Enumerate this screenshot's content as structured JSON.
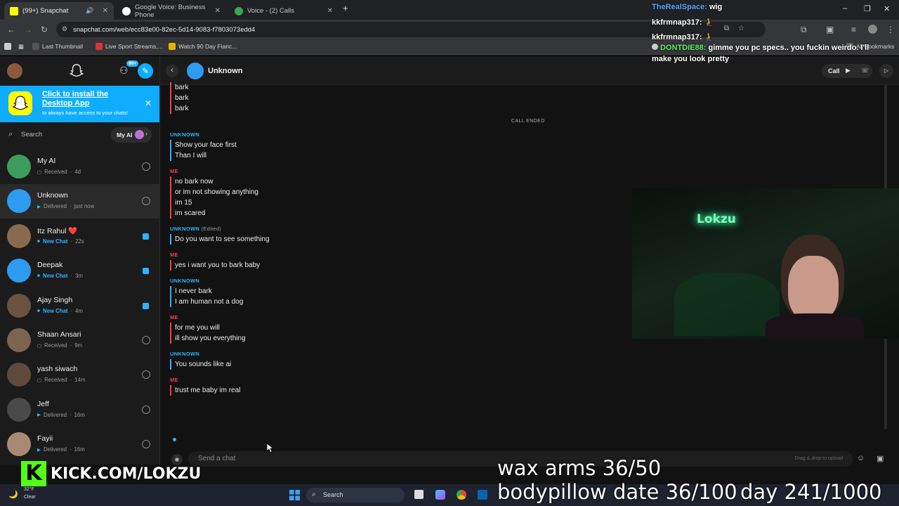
{
  "browser": {
    "tabs": [
      {
        "label": "(99+) Snapchat",
        "active": true
      },
      {
        "label": "Google Voice: Business Phone",
        "active": false
      },
      {
        "label": "Voice - (2) Calls",
        "active": false
      }
    ],
    "url": "snapchat.com/web/ecc83e00-82ec-5d14-9083-f7803073edd4",
    "bookmarks": [
      "Last Thumbnail",
      "Live Sport Streams,...",
      "Watch 90 Day Fianc...",
      "All Bookmarks"
    ]
  },
  "sidebar": {
    "badge": "99+",
    "promo": {
      "title": "Click to install the Desktop App",
      "subtitle": "to always have access to your chats!"
    },
    "search_placeholder": "Search",
    "my_ai_label": "My AI",
    "contacts": [
      {
        "name": "My AI",
        "status": "Received",
        "time": "4d",
        "kind": "received",
        "avatar": "#3b9c5b"
      },
      {
        "name": "Unknown",
        "status": "Delivered",
        "time": "just now",
        "kind": "delivered",
        "avatar": "#2d9bf0",
        "selected": true
      },
      {
        "name": "Itz Rahul ❤️",
        "status": "New Chat",
        "time": "22s",
        "kind": "new",
        "avatar": "#8a6a4f"
      },
      {
        "name": "Deepak",
        "status": "New Chat",
        "time": "3m",
        "kind": "new",
        "avatar": "#2d9bf0"
      },
      {
        "name": "Ajay Singh",
        "status": "New Chat",
        "time": "4m",
        "kind": "new",
        "avatar": "#6b5240"
      },
      {
        "name": "Shaan Ansari",
        "status": "Received",
        "time": "9m",
        "kind": "received",
        "avatar": "#7c6450"
      },
      {
        "name": "yash siwach",
        "status": "Received",
        "time": "14m",
        "kind": "received",
        "avatar": "#5d4a3b"
      },
      {
        "name": "Jeff",
        "status": "Delivered",
        "time": "16m",
        "kind": "delivered",
        "avatar": "#4a4a4a"
      },
      {
        "name": "Fayii",
        "status": "Delivered",
        "time": "16m",
        "kind": "delivered",
        "avatar": "#a88a74"
      }
    ]
  },
  "chat": {
    "title": "Unknown",
    "call_label": "Call",
    "call_ended": "CALL ENDED",
    "top_lines": [
      "bark",
      "bark",
      "bark"
    ],
    "messages": [
      {
        "sender": "UNKNOWN",
        "from": "them",
        "lines": [
          "Show your face first",
          "Than I will"
        ]
      },
      {
        "sender": "ME",
        "from": "me",
        "lines": [
          "no bark now",
          "or im not showing anything",
          "im 15",
          "im scared"
        ]
      },
      {
        "sender": "UNKNOWN",
        "edited": "(Edited)",
        "from": "them",
        "lines": [
          "Do you want to see something"
        ]
      },
      {
        "sender": "ME",
        "from": "me",
        "lines": [
          "yes i want you to bark baby"
        ]
      },
      {
        "sender": "UNKNOWN",
        "from": "them",
        "lines": [
          "I never bark",
          "I am human not a dog"
        ]
      },
      {
        "sender": "ME",
        "from": "me",
        "lines": [
          "for me you will",
          "ill show you everything"
        ]
      },
      {
        "sender": "UNKNOWN",
        "from": "them",
        "lines": [
          "You sounds like ai"
        ]
      },
      {
        "sender": "ME",
        "from": "me",
        "lines": [
          "trust me baby im real"
        ]
      }
    ],
    "composer_placeholder": "Send a chat",
    "drop_hint": "Drag & drop to upload"
  },
  "stream_chat": [
    {
      "user": "TheRealSpace:",
      "text": "wig",
      "color": "#5aa8ff"
    },
    {
      "user": "kkfrmnap317:",
      "text": "🧎",
      "color": "#ffffff"
    },
    {
      "user": "kkfrmnap317:",
      "text": "🧎",
      "color": "#ffffff"
    },
    {
      "user": "DONTDIE88:",
      "text": "gimme you pc specs.. you fuckin weirdo. I'll make you look pretty",
      "color": "#5cf05c"
    }
  ],
  "overlay": {
    "kick": "KICK.COM/LOKZU",
    "wax": "wax arms 36/50",
    "bodypillow": "bodypillow date 36/100",
    "day": "day 241/1000",
    "neon_sign": "Lokzu"
  },
  "taskbar": {
    "weather_temp": "32°F",
    "weather_desc": "Clear",
    "search": "Search"
  }
}
